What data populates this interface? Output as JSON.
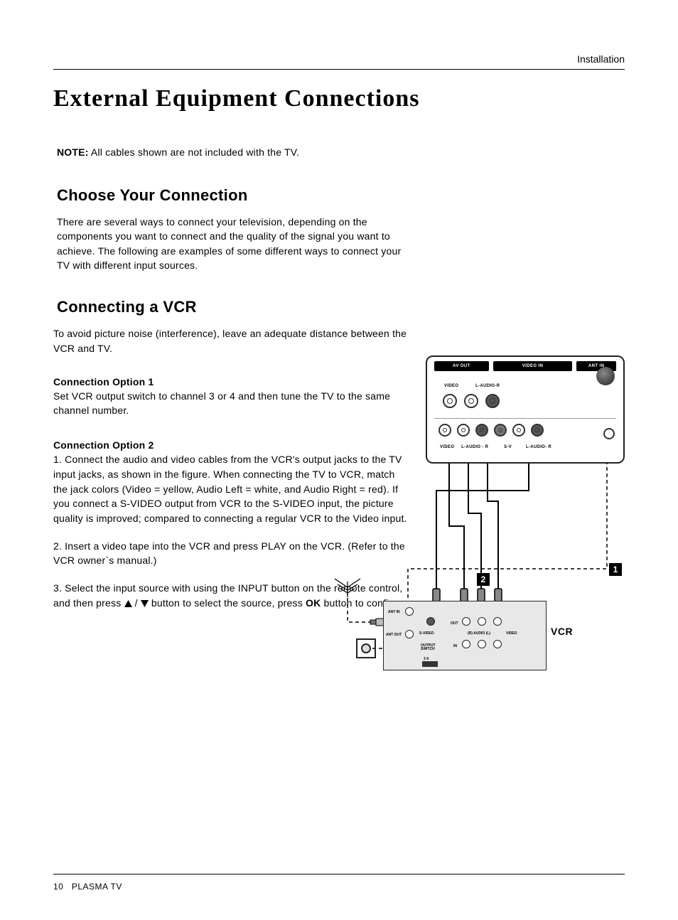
{
  "header": {
    "section_label": "Installation"
  },
  "title": "External Equipment Connections",
  "note": {
    "prefix": "NOTE:",
    "text": " All cables shown are not included with the TV."
  },
  "choose": {
    "heading": "Choose Your Connection",
    "body": "There are several ways to connect your television, depending on the components you want to connect and the quality of the signal you want to achieve.  The following are examples of some different ways to connect your TV with different input sources."
  },
  "vcr": {
    "heading": "Connecting a VCR",
    "intro": "To avoid picture noise (interference), leave an adequate distance between the VCR and TV.",
    "opt1": {
      "head": "Connection Option 1",
      "body": "Set VCR output switch to channel 3 or 4 and then tune the TV to the same channel number."
    },
    "opt2": {
      "head": "Connection Option 2",
      "p1": "1. Connect the audio and video cables from the VCR's output jacks to the TV input jacks, as shown in the figure. When connecting the TV to VCR, match the jack colors (Video = yellow, Audio Left = white, and Audio Right = red). If you connect a S-VIDEO output from VCR to the S-VIDEO input, the picture quality is improved; compared to connecting a regular VCR to the Video input.",
      "p2": "2. Insert a video tape into the VCR and press PLAY on the VCR. (Refer to the VCR owner`s manual.)",
      "p3a": "3. Select the input source with using the INPUT button on the remote control, and then press ",
      "p3b": " button to select the source, press ",
      "ok": "OK",
      "p3c": " button to confirm."
    }
  },
  "diagram": {
    "tv_top": [
      "AV OUT",
      "VIDEO IN",
      "ANT IN"
    ],
    "row1_labels": [
      "VIDEO",
      "L-AUDIO-R"
    ],
    "row2_labels": [
      "VIDEO",
      "L-AUDIO - R",
      "S-V",
      "L-AUDIO- R"
    ],
    "vcr": {
      "name": "VCR",
      "labels": {
        "ant_in": "ANT IN",
        "ant_out": "ANT OUT",
        "s_video": "S-VIDEO",
        "out": "OUT",
        "in": "IN",
        "r_audio_l": "(R) AUDIO (L)",
        "video": "VIDEO",
        "switch": "OUTPUT\nSWITCH",
        "switch_nums": "3   4"
      }
    },
    "badges": {
      "one": "1",
      "two": "2"
    }
  },
  "footer": {
    "page": "10",
    "product": "PLASMA TV"
  }
}
